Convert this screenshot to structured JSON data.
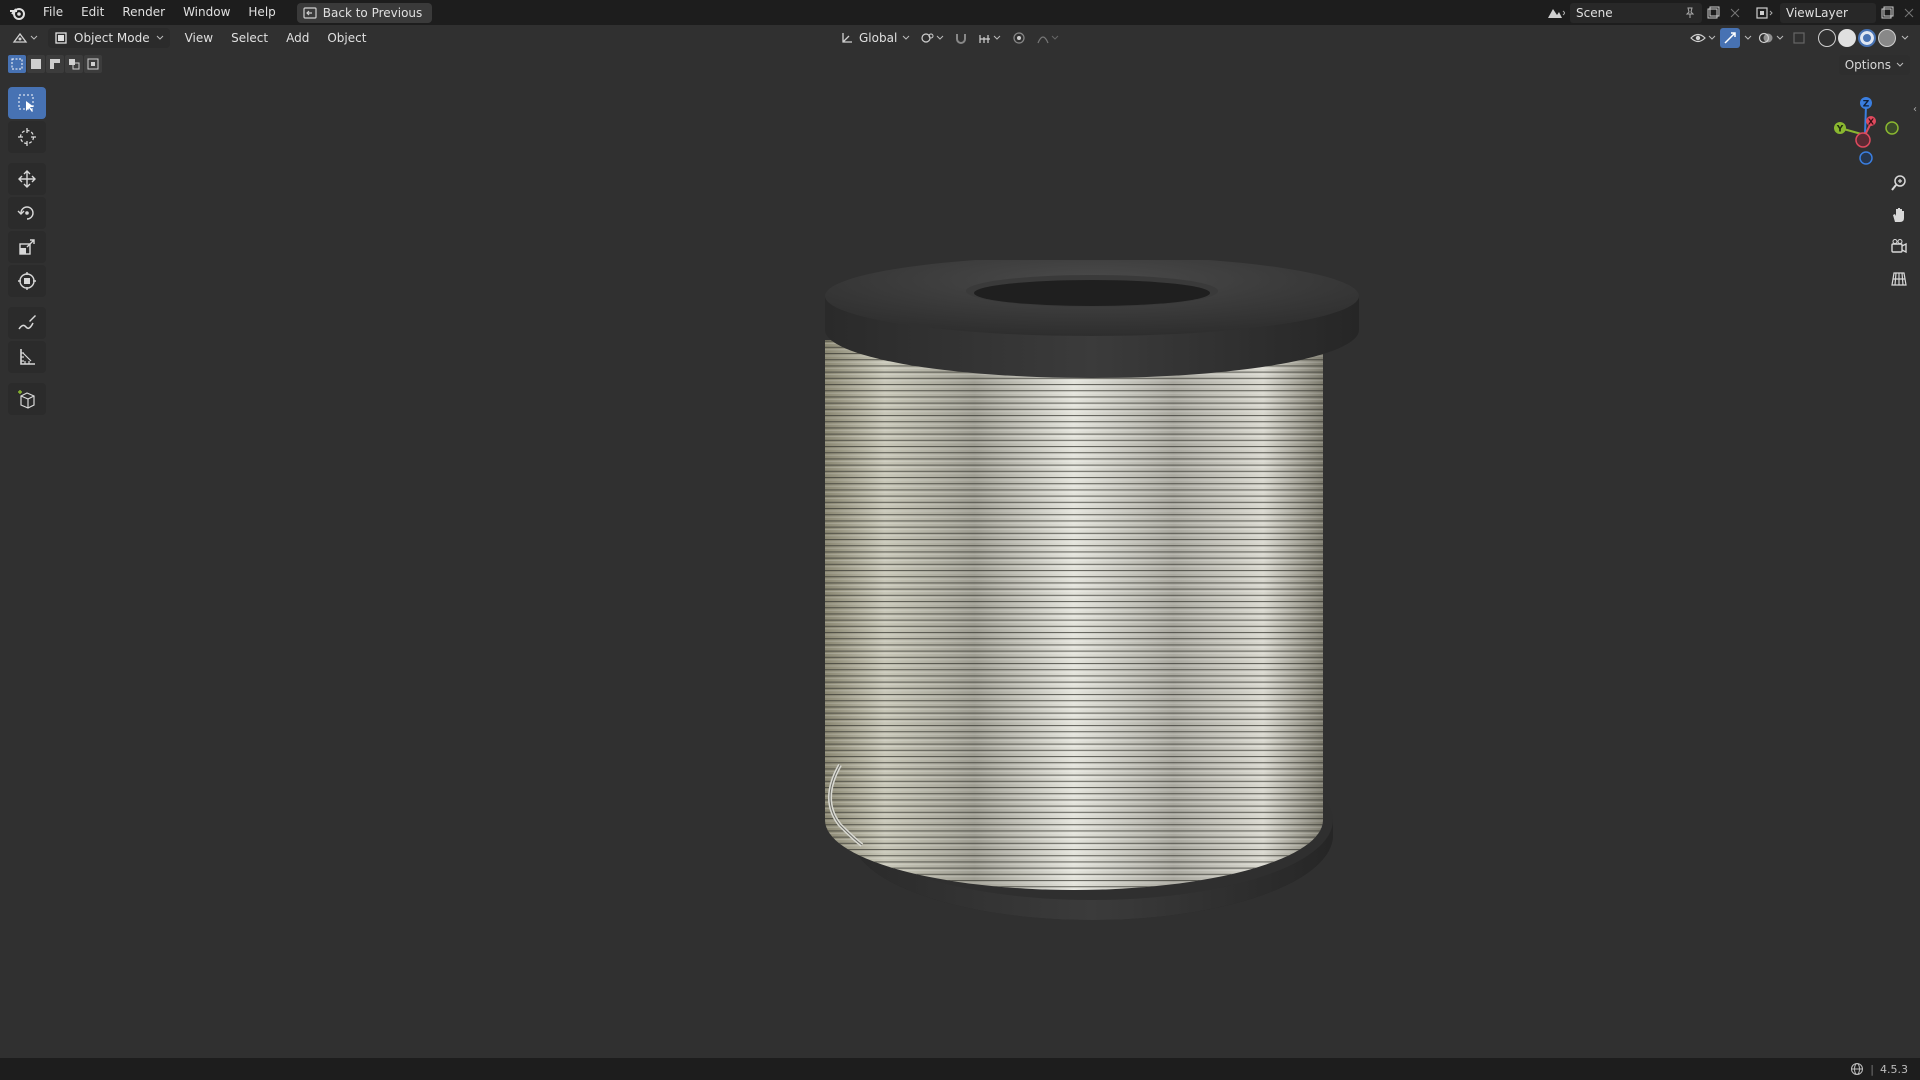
{
  "menubar": {
    "items": [
      "File",
      "Edit",
      "Render",
      "Window",
      "Help"
    ],
    "back_label": "Back to Previous",
    "scene_label": "Scene",
    "view_layer_label": "ViewLayer"
  },
  "header": {
    "mode_label": "Object Mode",
    "menu": [
      "View",
      "Select",
      "Add",
      "Object"
    ],
    "transform_orientation": "Global"
  },
  "viewport": {
    "options_label": "Options",
    "gizmo": {
      "x_label": "X",
      "y_label": "Y",
      "z_label": "Z"
    },
    "object": "wire spool"
  },
  "toolbar": {
    "tools": [
      "select-box",
      "cursor",
      "move",
      "rotate",
      "scale",
      "transform",
      "annotate",
      "measure",
      "add-cube"
    ],
    "active_tool": "select-box"
  },
  "statusbar": {
    "version": "4.5.3"
  },
  "colors": {
    "accent": "#4772b3",
    "background": "#303030",
    "bar": "#1d1d1d",
    "axis_x": "#e04a5e",
    "axis_y": "#8ab730",
    "axis_z": "#3a7ee0"
  }
}
